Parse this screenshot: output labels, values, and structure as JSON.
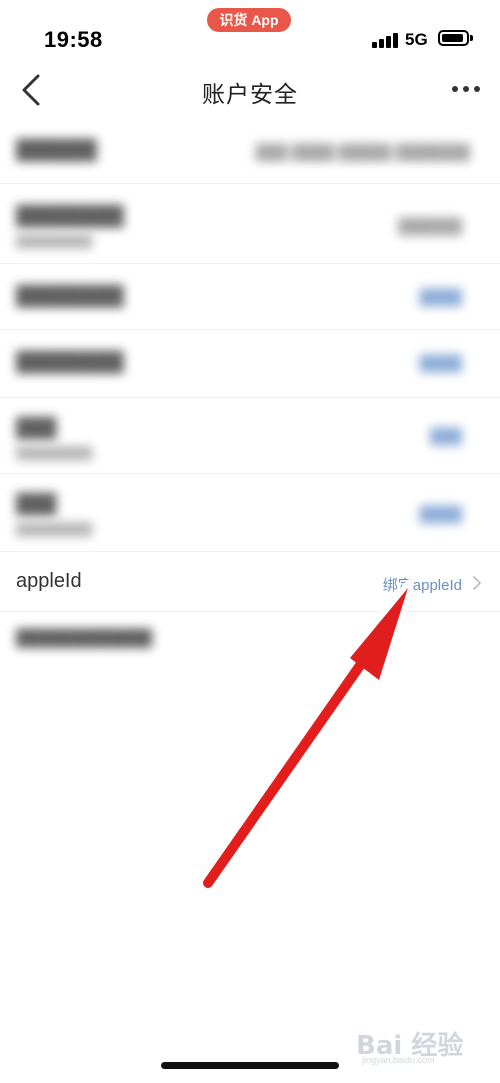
{
  "status_bar": {
    "time": "19:58",
    "app_badge": "识货 App",
    "network": "5G"
  },
  "nav": {
    "title": "账户安全"
  },
  "rows": [
    {
      "label": "██████",
      "value": "███ ████ █████ ███████",
      "blurred": true
    },
    {
      "label": "████████",
      "sub": "█████████",
      "value": "██████",
      "blurred": true
    },
    {
      "label": "████████",
      "value": "████",
      "blurred": true
    },
    {
      "label": "████████",
      "value": "████",
      "blurred": true
    },
    {
      "label": "███",
      "sub": "█████████",
      "value": "███",
      "blurred": true
    },
    {
      "label": "███",
      "sub": "█████████",
      "value": "████",
      "blurred": true
    },
    {
      "label": "appleId",
      "value": "绑定appleId",
      "blurred": false
    },
    {
      "label": "████████████",
      "value": "",
      "blurred": true
    }
  ],
  "watermark": {
    "text": "Bai 经验",
    "sub": "jingyan.baidu.com"
  },
  "colors": {
    "badge": "#e8574a",
    "link": "#6b8fc2",
    "arrow": "#e01e1e"
  }
}
